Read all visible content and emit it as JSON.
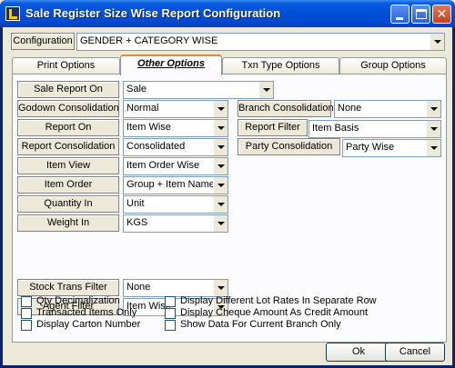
{
  "window": {
    "title": "Sale Register Size Wise Report Configuration"
  },
  "configuration": {
    "label": "Configuration",
    "value": "GENDER + CATEGORY WISE"
  },
  "tabs": [
    "Print Options",
    "Other Options",
    "Txn Type Options",
    "Group Options"
  ],
  "left_fields": [
    {
      "label": "Sale Report On",
      "value": "Sale"
    },
    {
      "label": "Godown Consolidation",
      "value": "Normal"
    },
    {
      "label": "Report On",
      "value": "Item Wise"
    },
    {
      "label": "Report Consolidation",
      "value": "Consolidated"
    },
    {
      "label": "Item View",
      "value": "Item Order Wise"
    },
    {
      "label": "Item Order",
      "value": "Group + Item Name"
    },
    {
      "label": "Quantity In",
      "value": "Unit"
    },
    {
      "label": "Weight In",
      "value": "KGS"
    }
  ],
  "right_fields": [
    {
      "label": "Branch Consolidation",
      "value": "None"
    },
    {
      "label": "Report Filter",
      "value": "Item Basis"
    },
    {
      "label": "Party Consolidation",
      "value": "Party Wise"
    }
  ],
  "filters": [
    {
      "label": "Stock Trans Filter",
      "value": "None"
    },
    {
      "label": "Agent Filter",
      "value": "Item Wise"
    }
  ],
  "checkboxes": [
    {
      "label": "Qty Decimalization",
      "checked": false
    },
    {
      "label": "Transacted Items Only",
      "checked": false
    },
    {
      "label": "Display Carton Number",
      "checked": false
    },
    {
      "label": "Display Different Lot Rates In Separate Row",
      "checked": false
    },
    {
      "label": "Display Cheque Amount As Credit Amount",
      "checked": false
    },
    {
      "label": "Show Data For Current Branch Only",
      "checked": false
    }
  ],
  "buttons": {
    "ok": "Ok",
    "cancel": "Cancel"
  }
}
